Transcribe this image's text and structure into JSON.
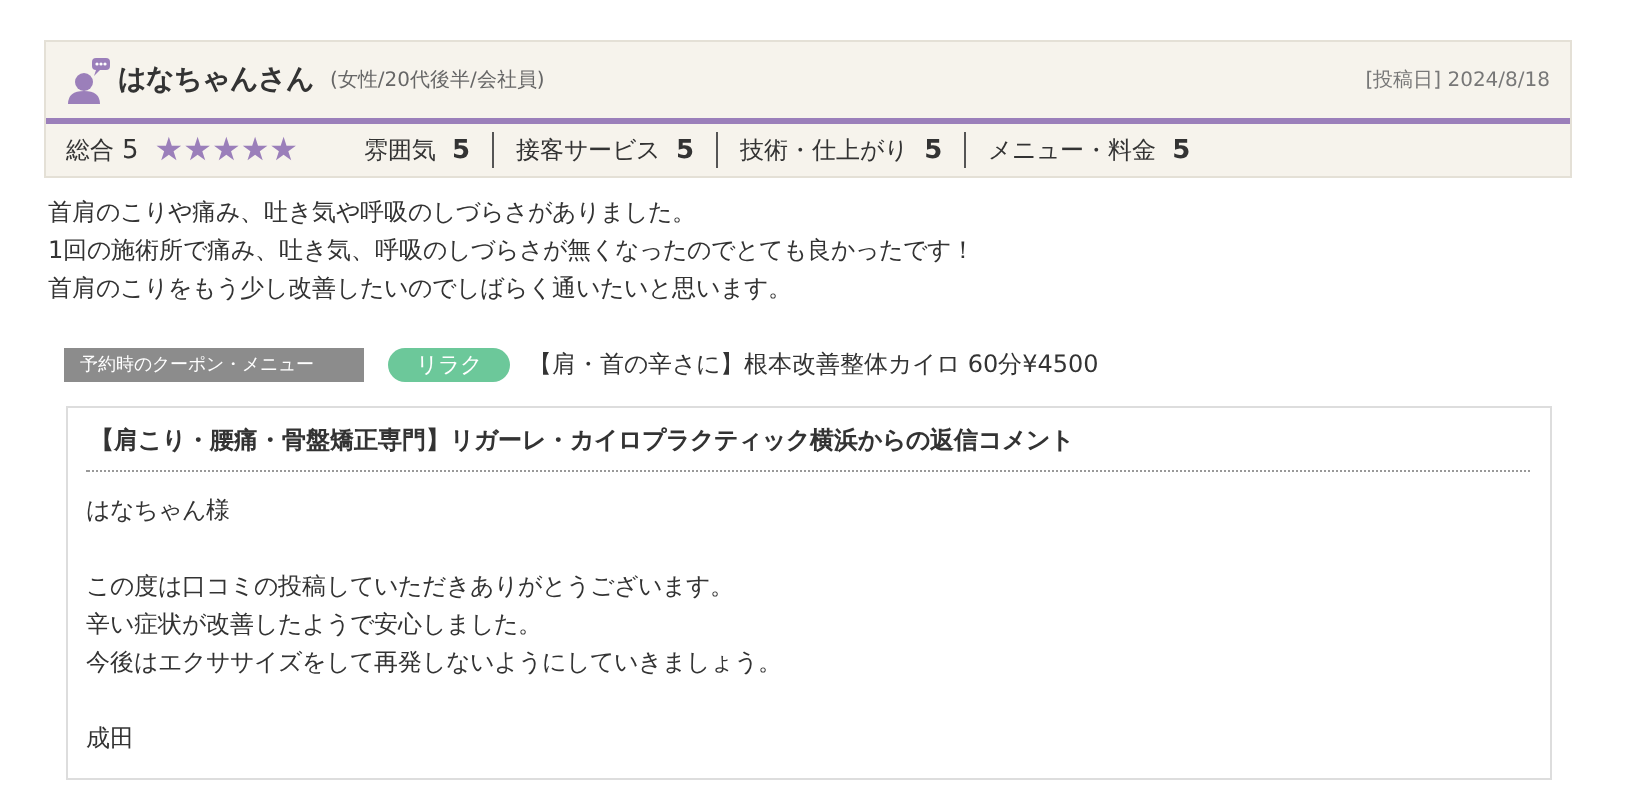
{
  "reviewer": {
    "name": "はなちゃんさん",
    "profile": "(女性/20代後半/会社員)",
    "date": "[投稿日] 2024/8/18"
  },
  "overall": {
    "label": "総合",
    "value": "5",
    "stars": 5
  },
  "ratings": [
    {
      "label": "雰囲気",
      "value": "5"
    },
    {
      "label": "接客サービス",
      "value": "5"
    },
    {
      "label": "技術・仕上がり",
      "value": "5"
    },
    {
      "label": "メニュー・料金",
      "value": "5"
    }
  ],
  "body": [
    "首肩のこりや痛み、吐き気や呼吸のしづらさがありました。",
    "1回の施術所で痛み、吐き気、呼吸のしづらさが無くなったのでとても良かったです！",
    "首肩のこりをもう少し改善したいのでしばらく通いたいと思います。"
  ],
  "coupon": {
    "label": "予約時のクーポン・メニュー",
    "tag": "リラク",
    "menu": "【肩・首の辛さに】根本改善整体カイロ 60分¥4500"
  },
  "reply": {
    "title": "【肩こり・腰痛・骨盤矯正専門】リガーレ・カイロプラクティック横浜からの返信コメント",
    "paragraphs": [
      [
        "はなちゃん様"
      ],
      [
        "この度は口コミの投稿していただきありがとうございます。",
        "辛い症状が改善したようで安心しました。",
        "今後はエクササイズをして再発しないようにしていきましょう。"
      ],
      [
        "成田"
      ]
    ]
  }
}
